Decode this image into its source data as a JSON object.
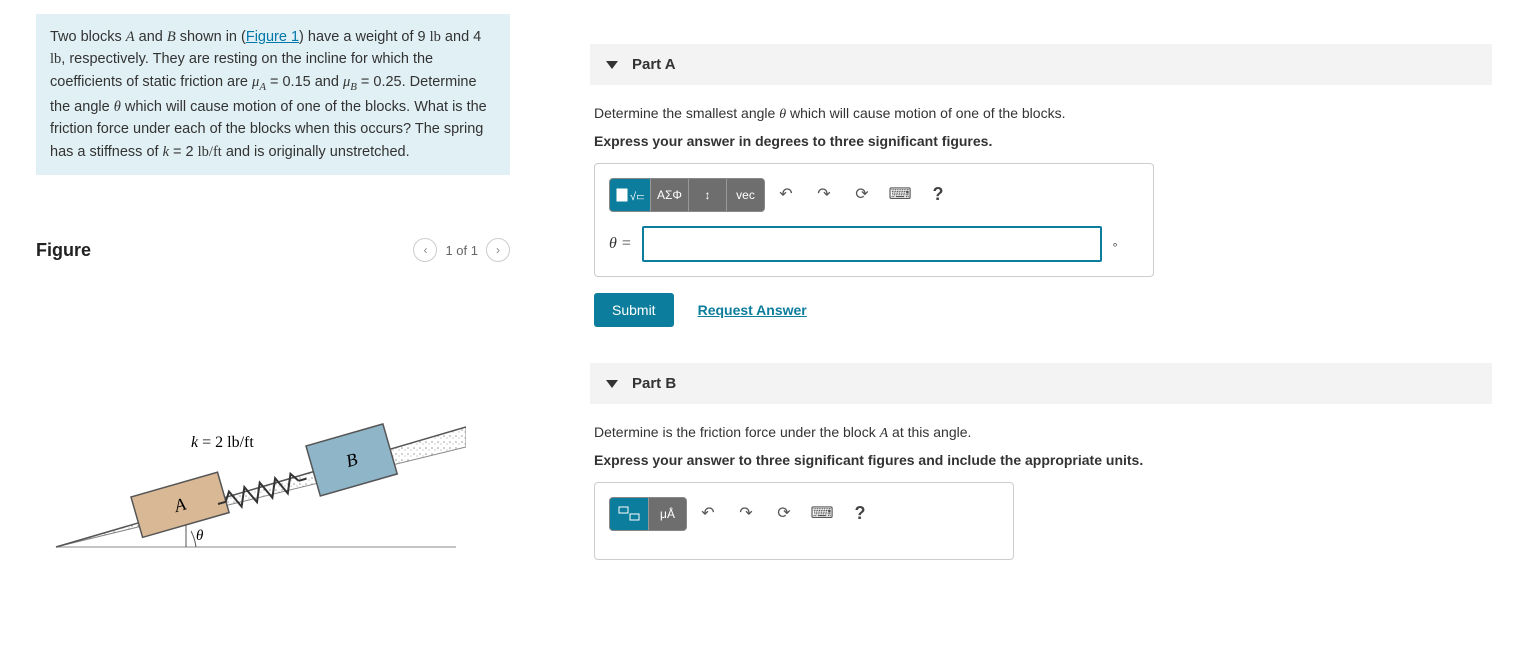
{
  "problem": {
    "text_pre": "Two blocks ",
    "block_a": "A",
    "text_and": " and ",
    "block_b": "B",
    "text_shown": " shown in (",
    "figure_link": "Figure 1",
    "text_weights": ") have a weight of 9 ",
    "unit_lb1": "lb",
    "text_and2": " and 4 ",
    "unit_lb2": "lb",
    "text_rest": ", respectively. They are resting on the incline for which the coefficients of static friction are ",
    "mu_a_sym": "μ",
    "mu_a_sub": "A",
    "mu_a_val": " = 0.15 and ",
    "mu_b_sym": "μ",
    "mu_b_sub": "B",
    "mu_b_val": " = 0.25. Determine the angle ",
    "theta1": "θ",
    "text_motion": " which will cause motion of one of the blocks. What is the friction force under each of the blocks when this occurs? The spring has a stiffness of ",
    "k_sym": "k",
    "k_val": " = 2 ",
    "k_unit": "lb/ft",
    "text_end": " and is originally unstretched."
  },
  "figure": {
    "title": "Figure",
    "page": "1 of 1",
    "spring_label": "k = 2 lb/ft",
    "block_a": "A",
    "block_b": "B",
    "angle": "θ"
  },
  "partA": {
    "title": "Part A",
    "prompt_pre": "Determine the smallest angle ",
    "theta": "θ",
    "prompt_post": " which will cause motion of one of the blocks.",
    "instructions": "Express your answer in degrees to three significant figures.",
    "var_label": "θ =",
    "unit": "∘",
    "submit": "Submit",
    "request": "Request Answer"
  },
  "partB": {
    "title": "Part B",
    "prompt_pre": "Determine is the friction force under the block ",
    "block": "A",
    "prompt_post": " at this angle.",
    "instructions": "Express your answer to three significant figures and include the appropriate units."
  },
  "toolbar": {
    "templates": "▭√▭",
    "greek": "ΑΣΦ",
    "subscript": "↕",
    "vec": "vec",
    "undo": "↶",
    "redo": "↷",
    "reset": "⟳",
    "keyboard": "⌨",
    "help": "?",
    "units_btn1": "▭▭",
    "units_btn2": "μÅ"
  }
}
